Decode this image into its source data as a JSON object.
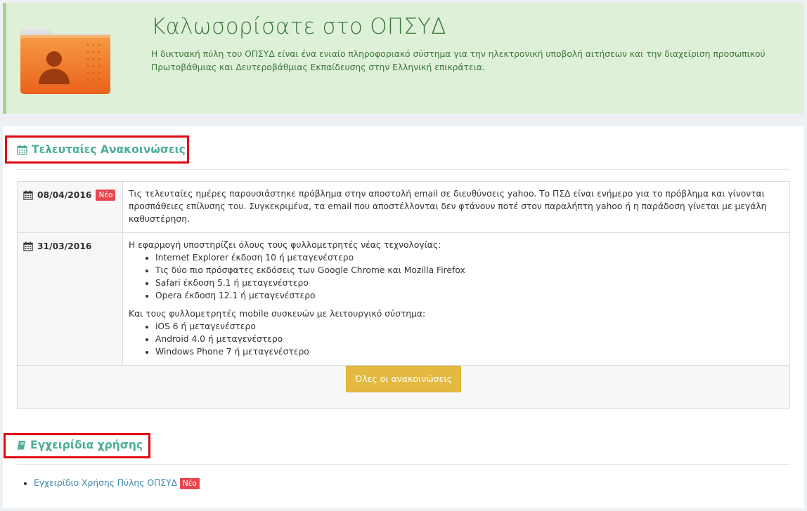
{
  "hero": {
    "title": "Καλωσορίσατε στο ΟΠΣΥΔ",
    "text": "Η δικτυακή πύλη του ΟΠΣΥΔ είναι ένα ενιαίο πληροφοριακό σύστημα για την ηλεκτρονική υποβολή αιτήσεων και την διαχείριση προσωπικού Πρωτοβάθμιας και Δευτεροβάθμιας Εκπαίδευσης στην Ελληνική επικράτεια."
  },
  "announcements": {
    "heading": "Τελευταίες Ανακοινώσεις",
    "items": [
      {
        "date": "08/04/2016",
        "badge": "Νέο",
        "text": "Τις τελευταίες ημέρες παρουσιάστηκε πρόβλημα στην αποστολή email σε διευθύνσεις yahoo. Το ΠΣΔ είναι ενήμερο για το πρόβλημα και γίνονται προσπάθειες επίλυσης του. Συγκεκριμένα, τα email που αποστέλλονται δεν φτάνουν ποτέ στον παραλήπτη yahoo ή η παράδοση γίνεται με μεγάλη καθυστέρηση."
      },
      {
        "date": "31/03/2016",
        "intro": "Η εφαρμογή υποστηρίζει όλους τους φυλλομετρητές νέας τεχνολογίας:",
        "browsers": [
          "Internet Explorer έκδοση 10 ή μεταγενέστερο",
          "Τις δύο πιο πρόσφατες εκδόσεις των Google Chrome και Mozilla Firefox",
          "Safari έκδοση 5.1 ή μεταγενέστερο",
          "Opera έκδοση 12.1 ή μεταγενέστερο"
        ],
        "mobile_intro": "Και τους φυλλομετρητές mobile συσκευών με λειτουργικό σύστημα:",
        "mobile": [
          "iOS 6 ή μεταγενέστερο",
          "Android 4.0 ή μεταγενέστερο",
          "Windows Phone 7 ή μεταγενέστερο"
        ]
      }
    ],
    "all_button": "Όλες οι ανακοινώσεις"
  },
  "manuals": {
    "heading": "Εγχειρίδια χρήσης",
    "items": [
      {
        "label": "Εγχειρίδιο Χρήσης Πύλης ΟΠΣΥΔ",
        "badge": "Νέο"
      }
    ]
  },
  "colors": {
    "hero_bg": "#dff0d8",
    "hero_text": "#3c763d",
    "heading": "#4cae9a",
    "badge": "#e8474f",
    "button": "#e3b93f",
    "highlight_box": "#e30613"
  },
  "icons": {
    "hero": "user-folder-icon",
    "announcements": "calendar-icon",
    "manuals": "book-icon"
  }
}
